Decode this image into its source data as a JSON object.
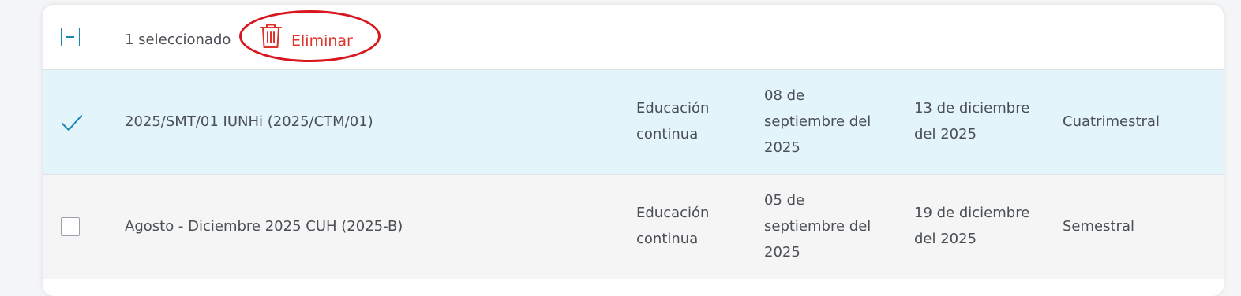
{
  "toolbar": {
    "selected_text": "1 seleccionado",
    "delete_label": "Eliminar"
  },
  "rows": [
    {
      "selected": true,
      "name": "2025/SMT/01 IUNHi (2025/CTM/01)",
      "type": "Educación continua",
      "start": "08 de septiembre del 2025",
      "end": "13 de diciembre del 2025",
      "period": "Cuatrimestral"
    },
    {
      "selected": false,
      "name": "Agosto - Diciembre 2025 CUH (2025-B)",
      "type": "Educación continua",
      "start": "05 de septiembre del 2025",
      "end": "19 de diciembre del 2025",
      "period": "Semestral"
    }
  ],
  "colors": {
    "accent": "#1a88b5",
    "danger": "#e0312b",
    "selected_row": "#e3f4fb",
    "row": "#f5f5f5",
    "text": "#4a4f55"
  },
  "icons": {
    "select_all": "minus-checkbox-icon",
    "delete": "trash-icon",
    "row_selected": "checkmark-icon",
    "row_unselected": "empty-checkbox-icon"
  }
}
